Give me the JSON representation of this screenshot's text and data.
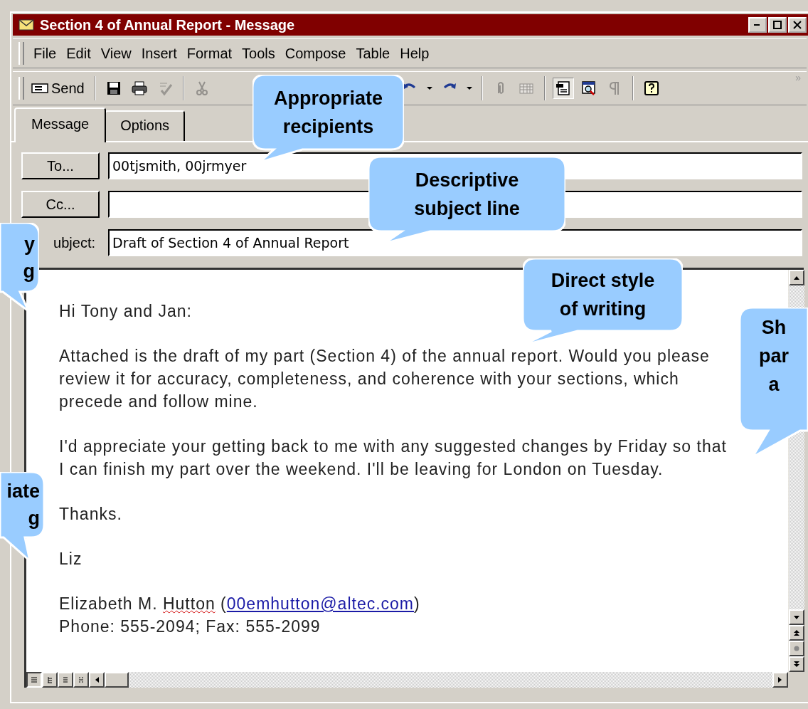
{
  "window": {
    "title": "Section 4 of Annual Report - Message"
  },
  "menu": [
    {
      "label": "File"
    },
    {
      "label": "Edit"
    },
    {
      "label": "View"
    },
    {
      "label": "Insert"
    },
    {
      "label": "Format"
    },
    {
      "label": "Tools"
    },
    {
      "label": "Compose"
    },
    {
      "label": "Table"
    },
    {
      "label": "Help"
    }
  ],
  "toolbar_overflow": "»",
  "toolbar": [
    {
      "kind": "send",
      "label": "Send"
    },
    {
      "kind": "separator"
    },
    {
      "kind": "save",
      "disabled": false
    },
    {
      "kind": "print",
      "disabled": false
    },
    {
      "kind": "spell",
      "disabled": true
    },
    {
      "kind": "separator"
    },
    {
      "kind": "cut",
      "disabled": true
    },
    {
      "kind": "gap"
    },
    {
      "kind": "undo",
      "disabled": false
    },
    {
      "kind": "dropdown",
      "disabled": false
    },
    {
      "kind": "redo",
      "disabled": false
    },
    {
      "kind": "dropdown",
      "disabled": false
    },
    {
      "kind": "separator"
    },
    {
      "kind": "attach",
      "disabled": true
    },
    {
      "kind": "table",
      "disabled": true
    },
    {
      "kind": "separator"
    },
    {
      "kind": "options",
      "pressed": true
    },
    {
      "kind": "preview",
      "pressed": false
    },
    {
      "kind": "pilcrow",
      "disabled": true
    },
    {
      "kind": "separator"
    },
    {
      "kind": "help",
      "disabled": false
    }
  ],
  "tabs": [
    {
      "label": "Message",
      "selected": true
    },
    {
      "label": "Options",
      "selected": false
    }
  ],
  "fields": [
    {
      "kind": "button",
      "label": "To...",
      "value": "00tjsmith, 00jrmyer"
    },
    {
      "kind": "button",
      "label": "Cc..."
    },
    {
      "kind": "label",
      "label": "ubject:",
      "value": "Draft of Section 4 of Annual Report"
    }
  ],
  "body": {
    "paragraphs": [
      {
        "lines": [
          "Hi Tony and Jan:"
        ]
      },
      {
        "lines": [
          "Attached is the draft of my part (Section 4) of the annual report. Would you please",
          "review it for accuracy, completeness, and coherence with your sections, which",
          "precede and follow mine."
        ]
      },
      {
        "lines": [
          "I'd appreciate your getting back to me with any suggested changes by Friday so that",
          "I can finish my part over the weekend. I'll be leaving for London on Tuesday."
        ]
      },
      {
        "lines": [
          "Thanks."
        ]
      },
      {
        "lines": [
          "Liz"
        ]
      }
    ],
    "signature": {
      "prefix": "Elizabeth M. ",
      "flagged_word": "Hutton",
      "open": " (",
      "email": "00emhutton@altec.com",
      "close": ")",
      "phone": "Phone: 555-2094; Fax: 555-2099"
    }
  },
  "callouts": [
    {
      "lines": [
        "Appropriate",
        "recipients"
      ]
    },
    {
      "lines": [
        "Descriptive",
        "subject line"
      ]
    },
    {
      "lines": [
        "Direct style",
        "of writing"
      ]
    },
    {
      "lines": [
        "Sh",
        "par",
        "a"
      ]
    },
    {
      "lines": [
        "y",
        "g"
      ]
    },
    {
      "lines": [
        "iate",
        "g"
      ]
    }
  ]
}
